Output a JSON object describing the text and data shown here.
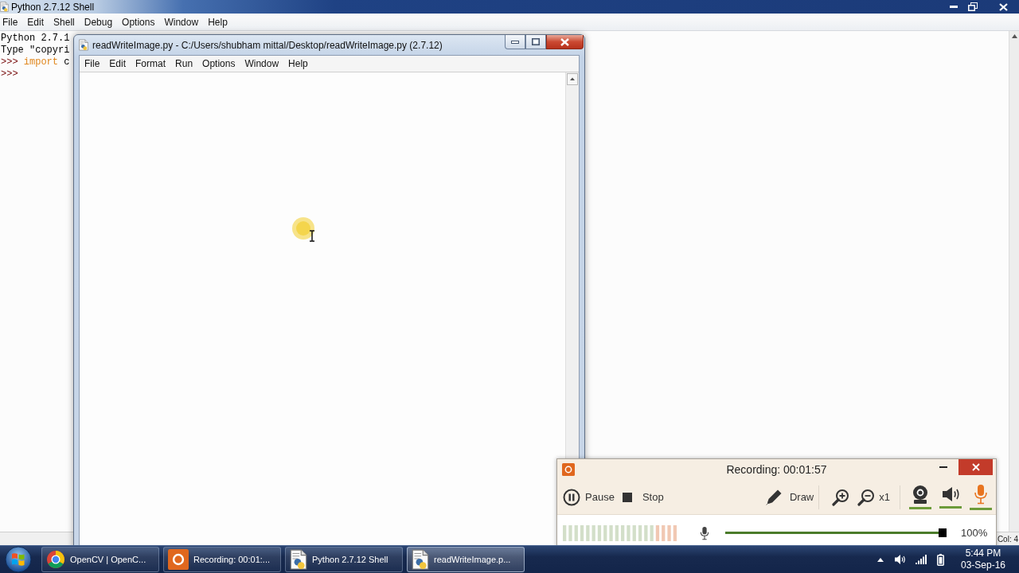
{
  "shell_window": {
    "title": "Python 2.7.12 Shell",
    "menu": [
      "File",
      "Edit",
      "Shell",
      "Debug",
      "Options",
      "Window",
      "Help"
    ],
    "lines": [
      [
        {
          "kind": "plain",
          "text": "Python 2.7.1"
        }
      ],
      [
        {
          "kind": "plain",
          "text": "Type \"copyri"
        }
      ],
      [
        {
          "kind": "prompt",
          "text": ">>>"
        },
        {
          "kind": "keyword",
          "text": "import"
        },
        {
          "kind": "plain",
          "text": "c"
        }
      ],
      [
        {
          "kind": "prompt",
          "text": ">>>"
        }
      ]
    ],
    "status": "Col: 4"
  },
  "editor_window": {
    "title": "readWriteImage.py - C:/Users/shubham mittal/Desktop/readWriteImage.py (2.7.12)",
    "menu": [
      "File",
      "Edit",
      "Format",
      "Run",
      "Options",
      "Window",
      "Help"
    ]
  },
  "recorder": {
    "title": "Recording: 00:01:57",
    "tools": [
      {
        "kind": "pause",
        "label": "Pause"
      },
      {
        "kind": "stop",
        "label": "Stop"
      },
      {
        "kind": "draw",
        "label": "Draw"
      },
      {
        "kind": "zoom_in"
      },
      {
        "kind": "zoom_out"
      },
      {
        "kind": "zoom_factor",
        "label": "x1"
      }
    ],
    "sources": [
      {
        "kind": "webcam",
        "on": true,
        "active": false
      },
      {
        "kind": "speaker",
        "on": true,
        "active": false
      },
      {
        "kind": "microphone",
        "on": true,
        "active": true
      }
    ],
    "mic_volume": {
      "level": 1,
      "reading": "100%"
    }
  },
  "taskbar": {
    "buttons": [
      {
        "kind": "browser",
        "label": "OpenCV | OpenC...",
        "selected": false
      },
      {
        "kind": "recorder",
        "label": "Recording: 00:01:...",
        "selected": false
      },
      {
        "kind": "script",
        "label": "Python 2.7.12 Shell",
        "selected": false
      },
      {
        "kind": "script",
        "label": "readWriteImage.p...",
        "selected": true
      }
    ],
    "clock": {
      "time": "5:44 PM",
      "date": "03-Sep-16"
    }
  }
}
